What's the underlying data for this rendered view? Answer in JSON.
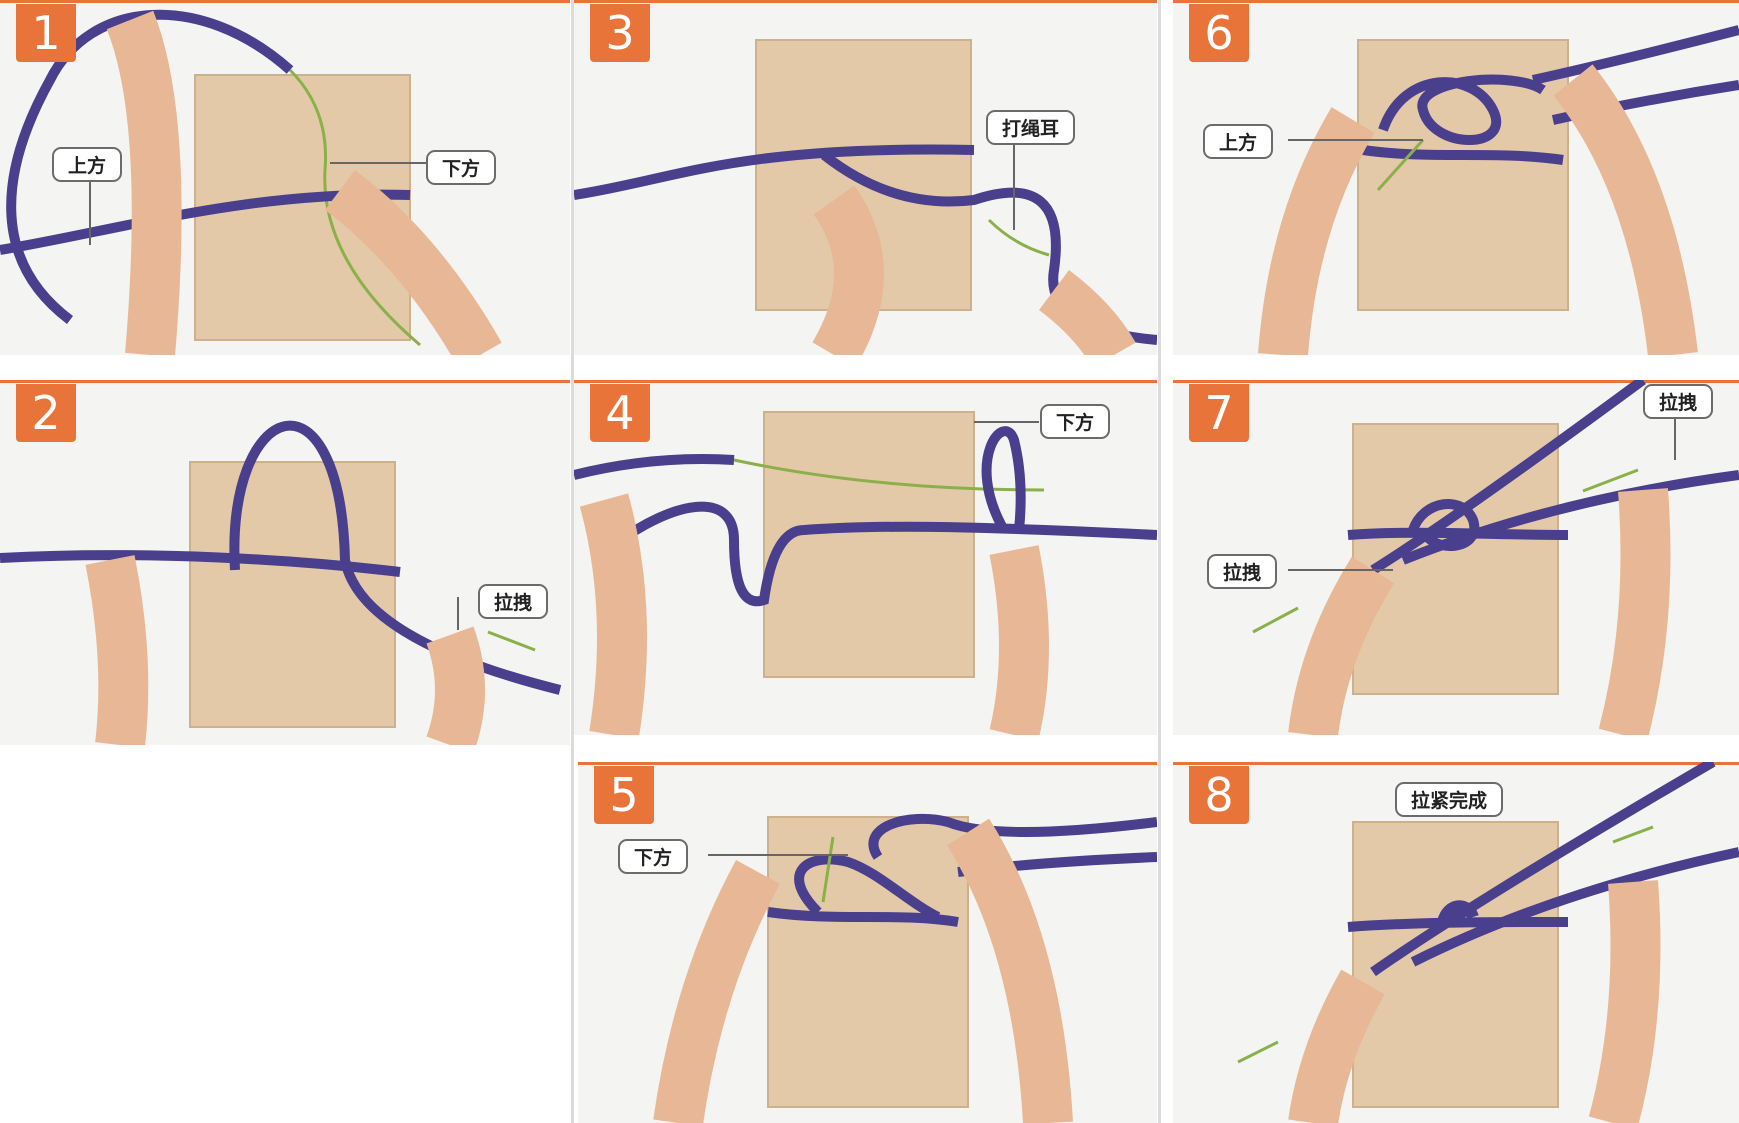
{
  "panels": [
    {
      "step": "1",
      "labels": [
        "上方",
        "下方"
      ]
    },
    {
      "step": "2",
      "labels": [
        "拉拽"
      ]
    },
    {
      "step": "3",
      "labels": [
        "打绳耳"
      ]
    },
    {
      "step": "4",
      "labels": [
        "下方"
      ]
    },
    {
      "step": "5",
      "labels": [
        "下方"
      ]
    },
    {
      "step": "6",
      "labels": [
        "上方"
      ]
    },
    {
      "step": "7",
      "labels": [
        "拉拽",
        "拉拽"
      ]
    },
    {
      "step": "8",
      "labels": [
        "拉紧完成"
      ]
    }
  ],
  "colors": {
    "accent": "#e8743a",
    "rope": "#4a3f8c",
    "board": "#e3c9a8",
    "arrow": "#8ab04a",
    "skin": "#e8b896"
  }
}
